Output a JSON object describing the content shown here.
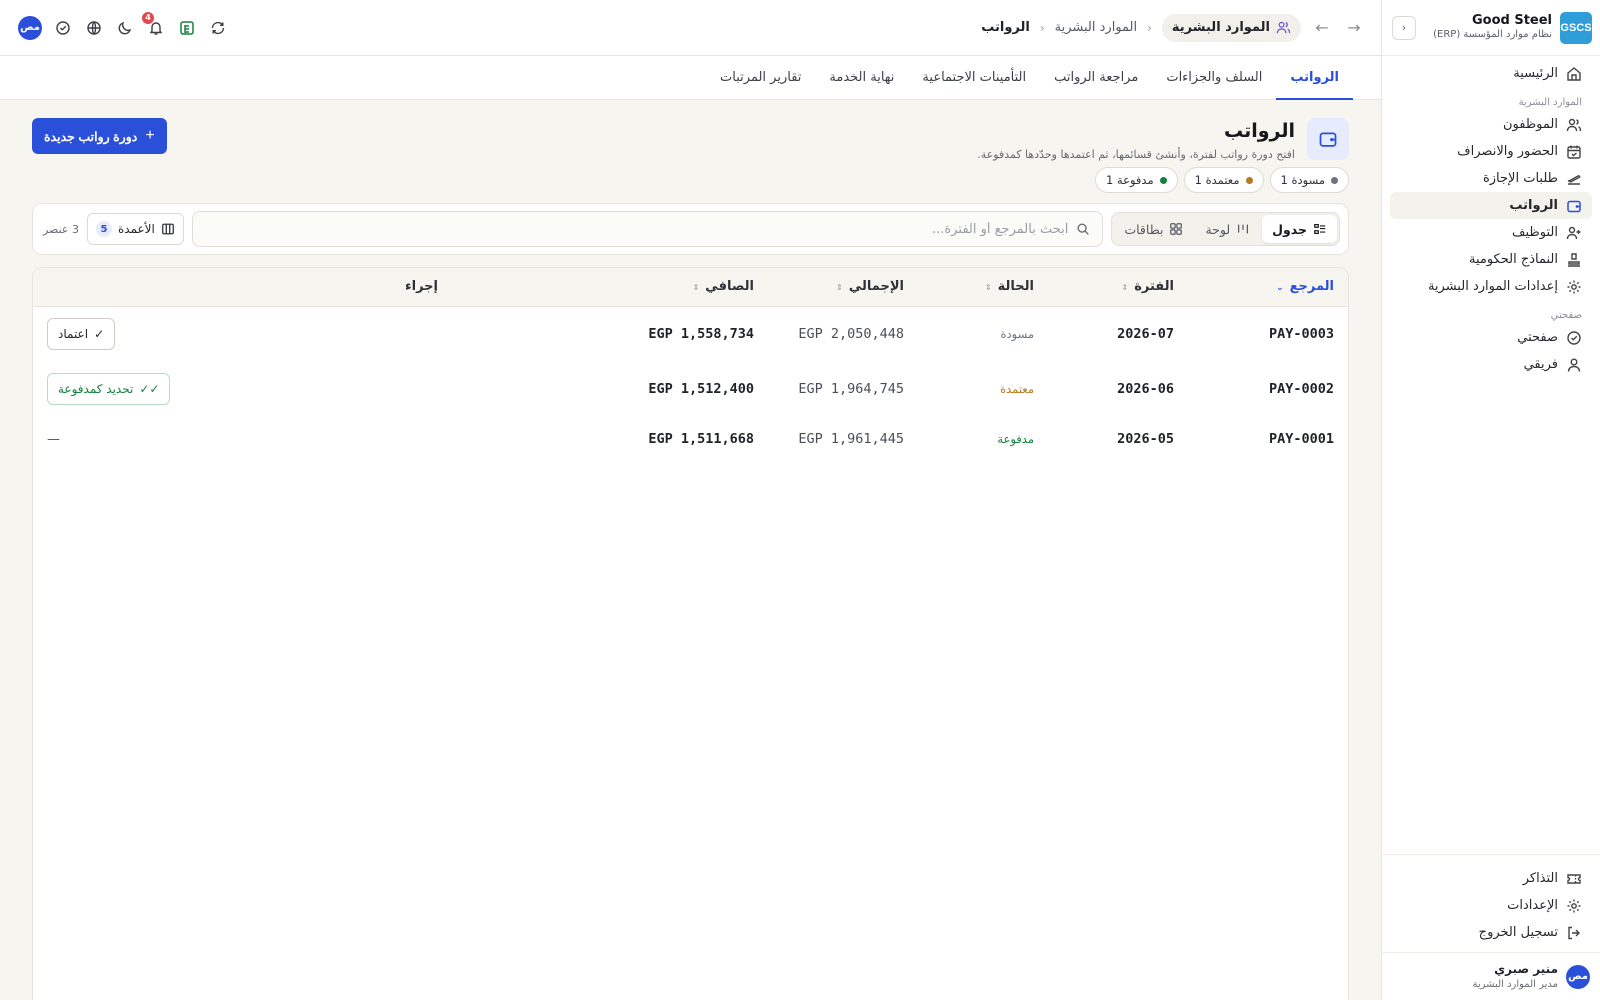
{
  "sidebar": {
    "logo": "GSCS",
    "brand_name": "Good Steel",
    "brand_sub": "نظام موارد المؤسسة (ERP)",
    "nav": [
      {
        "label": "الرئيسية"
      },
      {
        "group": "الموارد البشرية"
      },
      {
        "label": "الموظفون"
      },
      {
        "label": "الحضور والانصراف"
      },
      {
        "label": "طلبات الإجازة"
      },
      {
        "label": "الرواتب",
        "active": true
      },
      {
        "label": "التوظيف"
      },
      {
        "label": "النماذج الحكومية"
      },
      {
        "label": "إعدادات الموارد البشرية"
      },
      {
        "group": "صفحتي"
      },
      {
        "label": "صفحتي"
      },
      {
        "label": "فريقي"
      }
    ],
    "bottom": [
      {
        "label": "التذاكر"
      },
      {
        "label": "الإعدادات"
      },
      {
        "label": "تسجيل الخروج"
      }
    ],
    "user": {
      "initials": "مص",
      "name": "منير صبري",
      "role": "مدير الموارد البشرية"
    }
  },
  "topbar": {
    "breadcrumb": [
      "الموارد البشرية",
      "الموارد البشرية",
      "الرواتب"
    ],
    "notifications": "4",
    "avatar_initials": "مص"
  },
  "tabs": [
    {
      "label": "الرواتب",
      "active": true
    },
    {
      "label": "السلف والجزاءات"
    },
    {
      "label": "مراجعة الرواتب"
    },
    {
      "label": "التأمينات الاجتماعية"
    },
    {
      "label": "نهاية الخدمة"
    },
    {
      "label": "تقارير المرتبات"
    }
  ],
  "page": {
    "title": "الرواتب",
    "subtitle": "افتح دورة رواتب لفترة، وأنشئ قسائمها، ثم اعتمدها وحدّدها كمدفوعة.",
    "new_button": "دورة رواتب جديدة",
    "status_chips": [
      {
        "label": "مسودة 1",
        "color": "#6b7280"
      },
      {
        "label": "معتمدة 1",
        "color": "#b7791f"
      },
      {
        "label": "مدفوعة 1",
        "color": "#15803d"
      }
    ]
  },
  "toolbar": {
    "views": [
      {
        "label": "جدول",
        "active": true
      },
      {
        "label": "لوحة"
      },
      {
        "label": "بطاقات"
      }
    ],
    "search_placeholder": "ابحث بالمرجع أو الفترة...",
    "columns_label": "الأعمدة",
    "columns_count": "5",
    "item_count": "3 عنصر"
  },
  "table": {
    "columns": [
      "المرجع",
      "الفترة",
      "الحالة",
      "الإجمالي",
      "الصافي",
      "إجراء"
    ],
    "rows": [
      {
        "ref": "PAY-0003",
        "period": "2026-07",
        "status": "مسودة",
        "status_color": "#6b7280",
        "gross": "EGP 2,050,448",
        "net": "EGP 1,558,734",
        "action": "اعتماد"
      },
      {
        "ref": "PAY-0002",
        "period": "2026-06",
        "status": "معتمدة",
        "status_color": "#b7791f",
        "gross": "EGP 1,964,745",
        "net": "EGP 1,512,400",
        "action": "تحديد كمدفوعة"
      },
      {
        "ref": "PAY-0001",
        "period": "2026-05",
        "status": "مدفوعة",
        "status_color": "#15803d",
        "gross": "EGP 1,961,445",
        "net": "EGP 1,511,668",
        "action": "—"
      }
    ]
  },
  "colors": {
    "accent": "#2a4fd8",
    "logo": "#2f9ed8",
    "background": "#f6f5f0"
  }
}
